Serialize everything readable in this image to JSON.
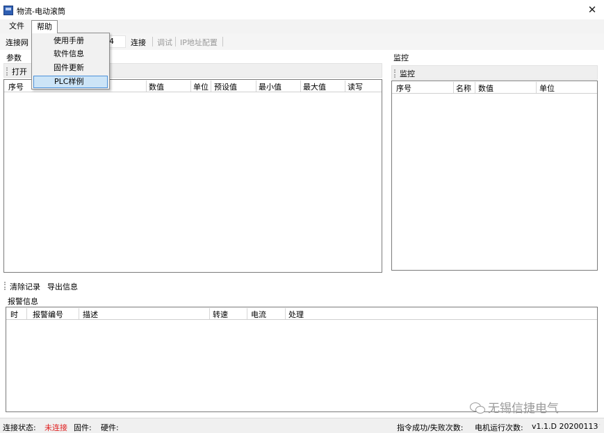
{
  "window": {
    "title": "物流-电动滚筒",
    "close_glyph": "✕"
  },
  "menu": {
    "file": "文件",
    "help": "帮助",
    "help_items": [
      "使用手册",
      "软件信息",
      "固件更新",
      "PLC样例"
    ]
  },
  "toolbar": {
    "connect_net_label": "连接网",
    "combo_value": "54",
    "connect": "连接",
    "debug": "调试",
    "ip_config": "IP地址配置"
  },
  "params": {
    "title": "参数",
    "open": "打开",
    "columns": [
      "序号",
      "数值",
      "单位",
      "预设值",
      "最小值",
      "最大值",
      "读写"
    ]
  },
  "monitor": {
    "title": "监控",
    "button": "监控",
    "columns": [
      "序号",
      "名称",
      "数值",
      "单位"
    ]
  },
  "log": {
    "clear": "清除记录",
    "export": "导出信息"
  },
  "alarm": {
    "title": "报警信息",
    "columns": [
      "时",
      "报警编号",
      "描述",
      "转速",
      "电流",
      "处理"
    ]
  },
  "status": {
    "conn_label": "连接状态:",
    "conn_value": "未连接",
    "firmware_label": "固件:",
    "hardware_label": "硬件:",
    "cmd_stats_label": "指令成功/失败次数:",
    "motor_runs_label": "电机运行次数:",
    "version": "v1.1.D 20200113"
  },
  "watermark": {
    "text": "无锡信捷电气"
  },
  "colors": {
    "status_disconnected": "#e02020",
    "menu_highlight": "#cce4f7",
    "menu_highlight_border": "#4a90d9"
  }
}
